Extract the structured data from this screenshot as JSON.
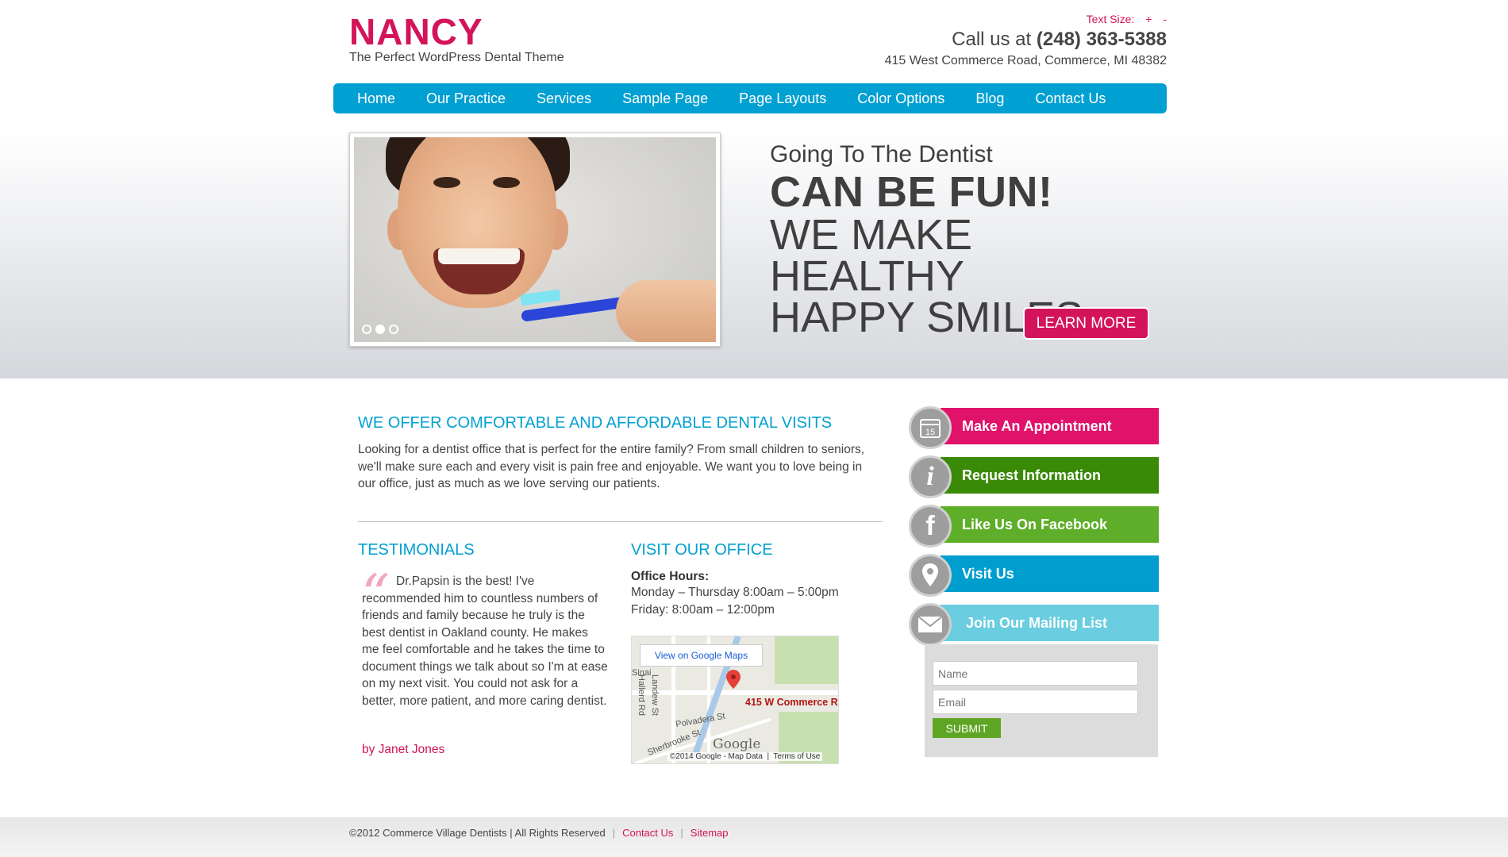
{
  "header": {
    "logo_title": "NANCY",
    "logo_tagline": "The Perfect WordPress Dental Theme",
    "text_size_label": "Text Size:",
    "text_size_plus": "+",
    "text_size_minus": "-",
    "call_prefix": "Call us at",
    "phone": "(248) 363-5388",
    "address": "415 West Commerce Road, Commerce, MI 48382"
  },
  "nav": {
    "items": [
      "Home",
      "Our Practice",
      "Services",
      "Sample Page",
      "Page Layouts",
      "Color Options",
      "Blog",
      "Contact Us"
    ]
  },
  "hero": {
    "line1": "Going To The Dentist",
    "line2": "CAN BE FUN!",
    "line3": "WE MAKE HEALTHY",
    "line4": "HAPPY SMILES",
    "cta": "LEARN MORE",
    "slider_active_index": 1,
    "slider_count": 3
  },
  "intro": {
    "title": "WE OFFER COMFORTABLE AND AFFORDABLE DENTAL VISITS",
    "text": "Looking for a dentist office that is perfect for the entire family? From small children to seniors, we'll make sure each and every visit is pain free and enjoyable. We want you to love being in our office, just as much as we love serving our patients."
  },
  "testimonials": {
    "title": "TESTIMONIALS",
    "quote_mark": "“",
    "text": "Dr.Papsin is the best! I've recommended him to countless numbers of friends and family because he truly is the best dentist in Oakland county. He makes me feel comfortable and he takes the time to document things we talk about so I'm at ease on my next visit. You could not ask for a better, more patient, and more caring dentist.",
    "author": "by Janet Jones"
  },
  "visit": {
    "title": "VISIT OUR OFFICE",
    "hours_label": "Office Hours:",
    "hours_1": "Monday – Thursday 8:00am – 5:00pm",
    "hours_2": "Friday: 8:00am – 12:00pm",
    "map": {
      "view_button": "View on Google Maps",
      "marker_label": "415 W Commerce R",
      "brand": "Google",
      "copyright": "©2014 Google - Map Data",
      "terms": "Terms of Use",
      "streets": [
        "Polvadera St",
        "Sherbrooke St",
        "Hallerd Rd",
        "Landew St",
        "Sinai"
      ]
    }
  },
  "sidebar": {
    "items": [
      {
        "label": "Make An Appointment",
        "icon": "calendar-icon",
        "icon_text": "15",
        "color": "#e0126a"
      },
      {
        "label": "Request Information",
        "icon": "info-icon",
        "icon_text": "i",
        "color": "#3a8a08"
      },
      {
        "label": "Like Us On Facebook",
        "icon": "facebook-icon",
        "icon_text": "f",
        "color": "#5fae2a"
      },
      {
        "label": "Visit Us",
        "icon": "map-marker-icon",
        "icon_text": "",
        "color": "#009dcf"
      },
      {
        "label": "Join Our Mailing List",
        "icon": "envelope-icon",
        "icon_text": "",
        "color": "#6acde0"
      }
    ],
    "mailing": {
      "name_placeholder": "Name",
      "email_placeholder": "Email",
      "submit_label": "SUBMIT"
    }
  },
  "footer": {
    "copyright": "©2012 Commerce Village Dentists | All Rights Reserved",
    "links": [
      "Contact Us",
      "Sitemap"
    ]
  },
  "colors": {
    "brand_pink": "#d4145a",
    "nav_blue": "#00a0d2"
  }
}
